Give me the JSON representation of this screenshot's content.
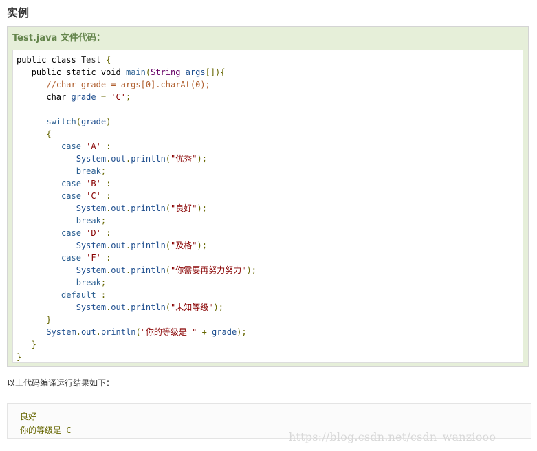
{
  "section": {
    "heading": "实例"
  },
  "example": {
    "title": "Test.java 文件代码："
  },
  "code_lines": [
    {
      "indent": 0,
      "segments": [
        [
          "kw",
          "public "
        ],
        [
          "kw",
          "class "
        ],
        [
          "pln",
          "Test "
        ],
        [
          "pun",
          "{"
        ]
      ]
    },
    {
      "indent": 1,
      "segments": [
        [
          "kw",
          "public "
        ],
        [
          "kw",
          "static "
        ],
        [
          "kw",
          "void "
        ],
        [
          "fn",
          "main"
        ],
        [
          "pun",
          "("
        ],
        [
          "typ",
          "String "
        ],
        [
          "id",
          "args"
        ],
        [
          "pun",
          "[]){"
        ]
      ]
    },
    {
      "indent": 2,
      "segments": [
        [
          "com",
          "//char grade = args[0].charAt(0);"
        ]
      ]
    },
    {
      "indent": 2,
      "segments": [
        [
          "kw",
          "char "
        ],
        [
          "id",
          "grade "
        ],
        [
          "pun",
          "= "
        ],
        [
          "str",
          "'C'"
        ],
        [
          "pun",
          ";"
        ]
      ]
    },
    {
      "indent": 0,
      "segments": []
    },
    {
      "indent": 2,
      "segments": [
        [
          "fn",
          "switch"
        ],
        [
          "pun",
          "("
        ],
        [
          "id",
          "grade"
        ],
        [
          "pun",
          ")"
        ]
      ]
    },
    {
      "indent": 2,
      "segments": [
        [
          "pun",
          "{"
        ]
      ]
    },
    {
      "indent": 3,
      "segments": [
        [
          "fn",
          "case "
        ],
        [
          "str",
          "'A' "
        ],
        [
          "pun",
          ":"
        ]
      ]
    },
    {
      "indent": 4,
      "segments": [
        [
          "id",
          "System"
        ],
        [
          "pun",
          "."
        ],
        [
          "id",
          "out"
        ],
        [
          "pun",
          "."
        ],
        [
          "id",
          "println"
        ],
        [
          "pun",
          "("
        ],
        [
          "str",
          "\"优秀\""
        ],
        [
          "pun",
          ");"
        ]
      ]
    },
    {
      "indent": 4,
      "segments": [
        [
          "fn",
          "break"
        ],
        [
          "pun",
          ";"
        ]
      ]
    },
    {
      "indent": 3,
      "segments": [
        [
          "fn",
          "case "
        ],
        [
          "str",
          "'B' "
        ],
        [
          "pun",
          ":"
        ]
      ]
    },
    {
      "indent": 3,
      "segments": [
        [
          "fn",
          "case "
        ],
        [
          "str",
          "'C' "
        ],
        [
          "pun",
          ":"
        ]
      ]
    },
    {
      "indent": 4,
      "segments": [
        [
          "id",
          "System"
        ],
        [
          "pun",
          "."
        ],
        [
          "id",
          "out"
        ],
        [
          "pun",
          "."
        ],
        [
          "id",
          "println"
        ],
        [
          "pun",
          "("
        ],
        [
          "str",
          "\"良好\""
        ],
        [
          "pun",
          ");"
        ]
      ]
    },
    {
      "indent": 4,
      "segments": [
        [
          "fn",
          "break"
        ],
        [
          "pun",
          ";"
        ]
      ]
    },
    {
      "indent": 3,
      "segments": [
        [
          "fn",
          "case "
        ],
        [
          "str",
          "'D' "
        ],
        [
          "pun",
          ":"
        ]
      ]
    },
    {
      "indent": 4,
      "segments": [
        [
          "id",
          "System"
        ],
        [
          "pun",
          "."
        ],
        [
          "id",
          "out"
        ],
        [
          "pun",
          "."
        ],
        [
          "id",
          "println"
        ],
        [
          "pun",
          "("
        ],
        [
          "str",
          "\"及格\""
        ],
        [
          "pun",
          ");"
        ]
      ]
    },
    {
      "indent": 3,
      "segments": [
        [
          "fn",
          "case "
        ],
        [
          "str",
          "'F' "
        ],
        [
          "pun",
          ":"
        ]
      ]
    },
    {
      "indent": 4,
      "segments": [
        [
          "id",
          "System"
        ],
        [
          "pun",
          "."
        ],
        [
          "id",
          "out"
        ],
        [
          "pun",
          "."
        ],
        [
          "id",
          "println"
        ],
        [
          "pun",
          "("
        ],
        [
          "str",
          "\"你需要再努力努力\""
        ],
        [
          "pun",
          ");"
        ]
      ]
    },
    {
      "indent": 4,
      "segments": [
        [
          "fn",
          "break"
        ],
        [
          "pun",
          ";"
        ]
      ]
    },
    {
      "indent": 3,
      "segments": [
        [
          "fn",
          "default "
        ],
        [
          "pun",
          ":"
        ]
      ]
    },
    {
      "indent": 4,
      "segments": [
        [
          "id",
          "System"
        ],
        [
          "pun",
          "."
        ],
        [
          "id",
          "out"
        ],
        [
          "pun",
          "."
        ],
        [
          "id",
          "println"
        ],
        [
          "pun",
          "("
        ],
        [
          "str",
          "\"未知等级\""
        ],
        [
          "pun",
          ");"
        ]
      ]
    },
    {
      "indent": 2,
      "segments": [
        [
          "pun",
          "}"
        ]
      ]
    },
    {
      "indent": 2,
      "segments": [
        [
          "id",
          "System"
        ],
        [
          "pun",
          "."
        ],
        [
          "id",
          "out"
        ],
        [
          "pun",
          "."
        ],
        [
          "id",
          "println"
        ],
        [
          "pun",
          "("
        ],
        [
          "str",
          "\"你的等级是 \" "
        ],
        [
          "pun",
          "+ "
        ],
        [
          "id",
          "grade"
        ],
        [
          "pun",
          ");"
        ]
      ]
    },
    {
      "indent": 1,
      "segments": [
        [
          "pun",
          "}"
        ]
      ]
    },
    {
      "indent": 0,
      "segments": [
        [
          "pun",
          "}"
        ]
      ]
    }
  ],
  "result": {
    "intro": "以上代码编译运行结果如下：",
    "lines": [
      "良好",
      "你的等级是 C"
    ]
  },
  "watermark": "https://blog.csdn.net/csdn_wanziooo"
}
